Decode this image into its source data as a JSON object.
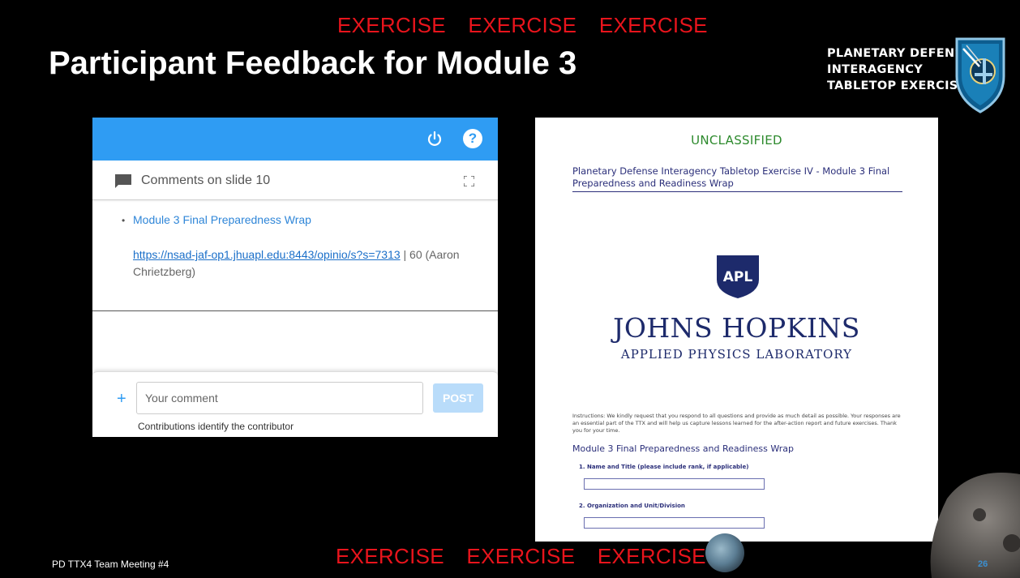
{
  "banner": {
    "top": [
      "EXERCISE",
      "EXERCISE",
      "EXERCISE"
    ],
    "bottom": [
      "EXERCISE",
      "EXERCISE",
      "EXERCISE"
    ],
    "color": "#e8141c"
  },
  "slide": {
    "title": "Participant Feedback for Module 3",
    "logo_lines": [
      "PLANETARY DEFENSE",
      "INTERAGENCY",
      "TABLETOP EXERCISE 4"
    ],
    "meeting_label": "PD TTX4 Team Meeting #4",
    "page_number": "26"
  },
  "comments_panel": {
    "accent": "#2f9cf3",
    "topbar_icons": [
      "power-icon",
      "help-icon"
    ],
    "help_glyph": "?",
    "header_title": "Comments on slide 10",
    "comment": {
      "bullet": "•",
      "title": "Module 3 Final Preparedness Wrap",
      "link": "https://nsad-jaf-op1.jhuapl.edu:8443/opinio/s?s=7313",
      "meta": " | 60  (Aaron Chrietzberg)"
    },
    "plus_glyph": "+",
    "input_placeholder": "Your comment",
    "post_label": "POST",
    "contributor_note": "Contributions identify the contributor"
  },
  "survey": {
    "classification": "UNCLASSIFIED",
    "title": "Planetary Defense Interagency Tabletop Exercise IV - Module 3 Final Preparedness and Readiness Wrap",
    "apl_badge": "APL",
    "org_name": "JOHNS HOPKINS",
    "lab_name": "APPLIED PHYSICS LABORATORY",
    "instructions": "Instructions: We kindly request that you respond to all questions and provide as much detail as possible. Your responses are an essential part of the TTX and will help us capture lessons learned for the after-action report and future exercises. Thank you for your time.",
    "module_heading": "Module 3 Final Preparedness and Readiness Wrap",
    "questions": [
      "1.  Name and Title  (please include rank, if applicable)",
      "2.  Organization and Unit/Division"
    ]
  }
}
